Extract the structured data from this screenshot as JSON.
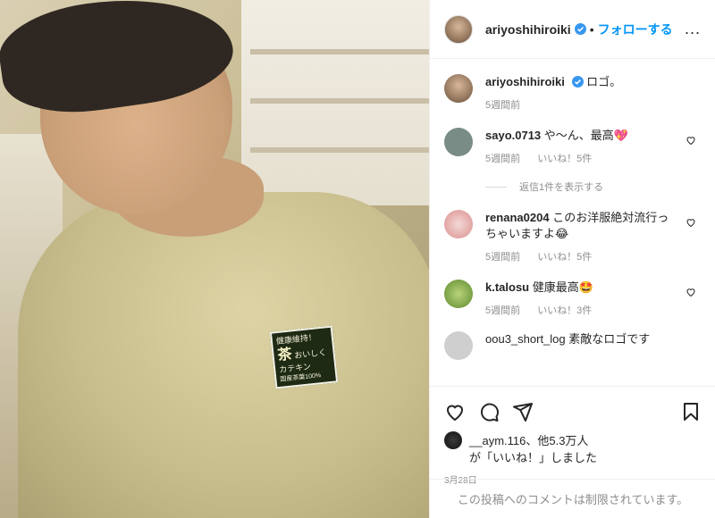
{
  "post": {
    "username": "ariyoshihiroiki",
    "follow_label": "フォローする",
    "dot": "•",
    "more_label": "...",
    "caption": "ロゴ。",
    "caption_time": "5週間前",
    "badge_line1": "健康維持！",
    "badge_big": "茶",
    "badge_line2": "おいしくカテキン",
    "badge_line3": "国産茶葉100%"
  },
  "comments": [
    {
      "user": "sayo.0713",
      "text": "や〜ん、最高💖",
      "time": "5週間前",
      "likes": "いいね！5件",
      "replies": "返信1件を表示する",
      "avatar": "#7a8c86"
    },
    {
      "user": "renana0204",
      "text": "このお洋服絶対流行っちゃいますよ😂",
      "time": "5週間前",
      "likes": "いいね！5件",
      "avatar": "#e8b9b7"
    },
    {
      "user": "k.talosu",
      "text": "健康最高🤩",
      "time": "5週間前",
      "likes": "いいね！3件",
      "avatar": "#8fae5a"
    }
  ],
  "partial_comment": "oou3_short_log 素敵なロゴです",
  "likes": {
    "line1": "__aym.116、他5.3万人",
    "line2": "が「いいね！」しました"
  },
  "date": "3月28日",
  "footer": "この投稿へのコメントは制限されています。",
  "colors": {
    "accent": "#0095f6",
    "verified": "#3897f0"
  }
}
